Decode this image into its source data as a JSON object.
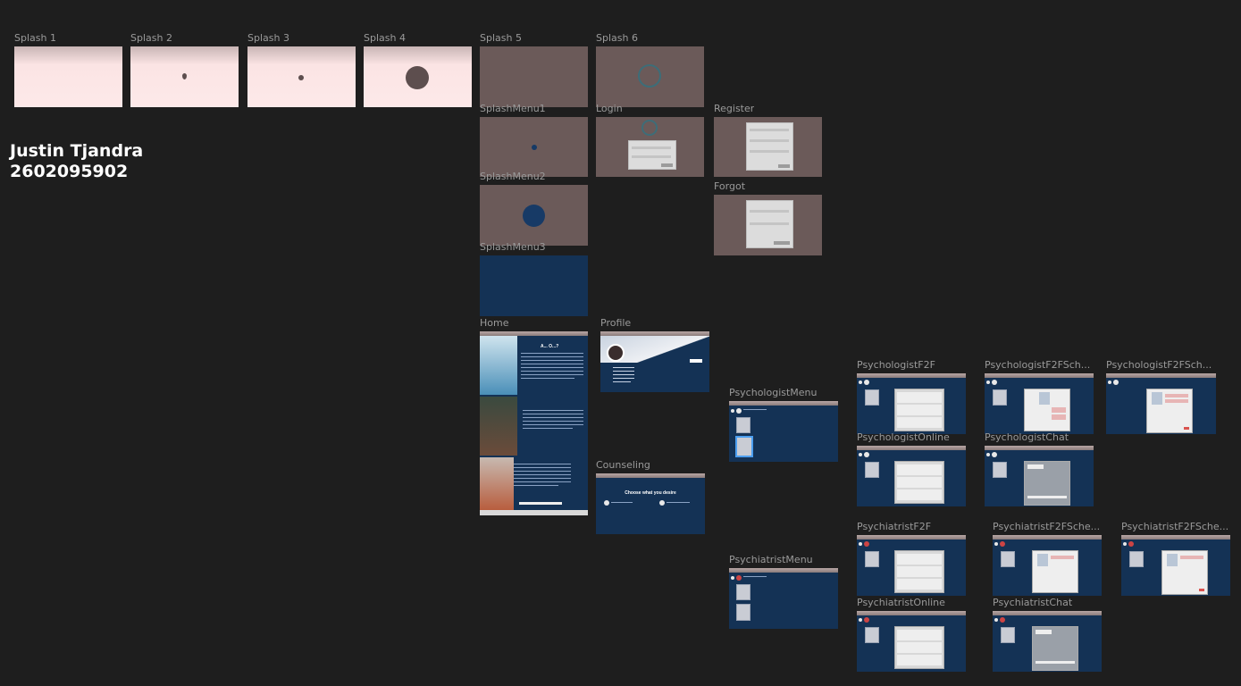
{
  "author": {
    "name": "Justin Tjandra",
    "id": "2602095902"
  },
  "frames": {
    "splash1": "Splash 1",
    "splash2": "Splash 2",
    "splash3": "Splash 3",
    "splash4": "Splash 4",
    "splash5": "Splash 5",
    "splash6": "Splash 6",
    "splashmenu1": "SplashMenu1",
    "splashmenu2": "SplashMenu2",
    "splashmenu3": "SplashMenu3",
    "login": "Login",
    "register": "Register",
    "forgot": "Forgot",
    "home": "Home",
    "profile": "Profile",
    "counseling": "Counseling",
    "psychologist_menu": "PsychologistMenu",
    "psychiatrist_menu": "PsychiatristMenu",
    "psychologist_f2f": "PsychologistF2F",
    "psychologist_f2f_sch1": "PsychologistF2FSch...",
    "psychologist_f2f_sch2": "PsychologistF2FSch...",
    "psychologist_online": "PsychologistOnline",
    "psychologist_chat": "PsychologistChat",
    "psychiatrist_f2f": "PsychiatristF2F",
    "psychiatrist_f2f_sche1": "PsychiatristF2FSche...",
    "psychiatrist_f2f_sche2": "PsychiatristF2FSche...",
    "psychiatrist_online": "PsychiatristOnline",
    "psychiatrist_chat": "PsychiatristChat"
  },
  "home_title": "A... O...?",
  "counseling_heading": "Choose what you desire",
  "colors": {
    "canvas": "#1e1e1e",
    "pink": "#fde9e9",
    "taupe": "#6b5a59",
    "navy": "#143255",
    "label": "#9a9a9a"
  }
}
